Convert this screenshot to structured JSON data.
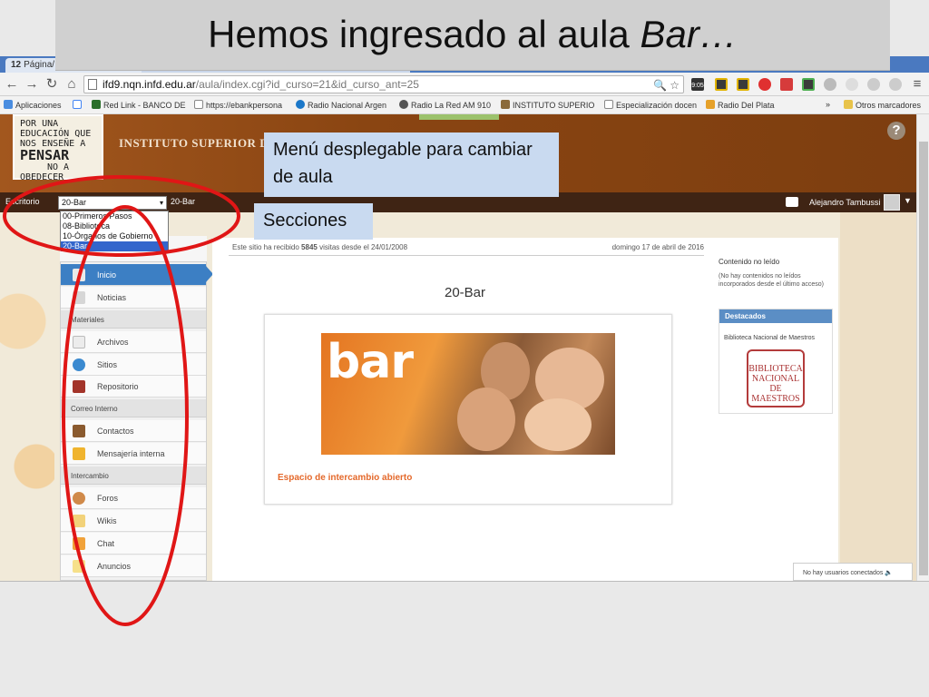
{
  "slide": {
    "title_main": "Hemos ingresado al aula ",
    "title_italic": "Bar…"
  },
  "browser": {
    "tab_number": "12",
    "tab_label": "Página/",
    "url_host": "ifd9.nqn.infd.edu.ar",
    "url_path": "/aula/index.cgi?id_curso=21&id_curso_ant=25",
    "bookmarks": [
      "Aplicaciones",
      "Red Link - BANCO DE",
      "https://ebankpersona",
      "Radio Nacional Argen",
      "Radio La Red AM 910",
      "INSTITUTO SUPERIOR",
      "Especialización docen",
      "Radio Del Plata",
      "»",
      "Otros marcadores"
    ],
    "ext_clock": "9:05"
  },
  "site": {
    "name": "INSTITUTO SUPERIOR D",
    "logo_lines": [
      "POR UNA",
      "EDUCACIÓN QUE",
      "NOS ENSEÑE A",
      "PENSAR",
      "NO A",
      "OBEDECER"
    ],
    "help": "?"
  },
  "toolbar": {
    "escritorio": "Escritorio",
    "aula_selected": "20-Bar",
    "aula_current": "20-Bar",
    "user_name": "Alejandro Tambussi"
  },
  "dropdown": {
    "options": [
      "00-Primeros Pasos",
      "08-Biblioteca",
      "10-Órganos de Gobierno",
      "20-Bar"
    ]
  },
  "sidebar": {
    "items": [
      {
        "label": "Inicio"
      },
      {
        "label": "Noticias"
      },
      {
        "section": "Materiales"
      },
      {
        "label": "Archivos"
      },
      {
        "label": "Sitios"
      },
      {
        "label": "Repositorio"
      },
      {
        "section": "Correo Interno"
      },
      {
        "label": "Contactos"
      },
      {
        "label": "Mensajería interna"
      },
      {
        "section": "Intercambio"
      },
      {
        "label": "Foros"
      },
      {
        "label": "Wikis"
      },
      {
        "label": "Chat"
      },
      {
        "label": "Anuncios"
      }
    ]
  },
  "main": {
    "visits_prefix": "Este sitio ha recibido ",
    "visits_count": "5845",
    "visits_suffix": " visitas desde el 24/01/2008",
    "date": "domingo 17 de abril de 2016",
    "course_title": "20-Bar",
    "banner_word": "bar",
    "space_label": "Espacio de intercambio abierto"
  },
  "right": {
    "title": "Contenido no leído",
    "empty": "(No hay contenidos no leídos incorporados desde el último acceso)",
    "destacados": "Destacados",
    "biblio": "Biblioteca Nacional de Maestros",
    "biblio_logo": "BIBLIOTECA NACIONAL DE MAESTROS"
  },
  "chat": {
    "status": "No hay usuarios conectados"
  },
  "callouts": {
    "menu": "Menú desplegable para cambiar de aula",
    "secciones": "Secciones"
  },
  "colors": {
    "annotation": "#e01616",
    "callout_bg": "#c9daf0",
    "active_item": "#3c7fc4",
    "header_brown": "#8a4512",
    "accent_orange": "#e4682a"
  }
}
